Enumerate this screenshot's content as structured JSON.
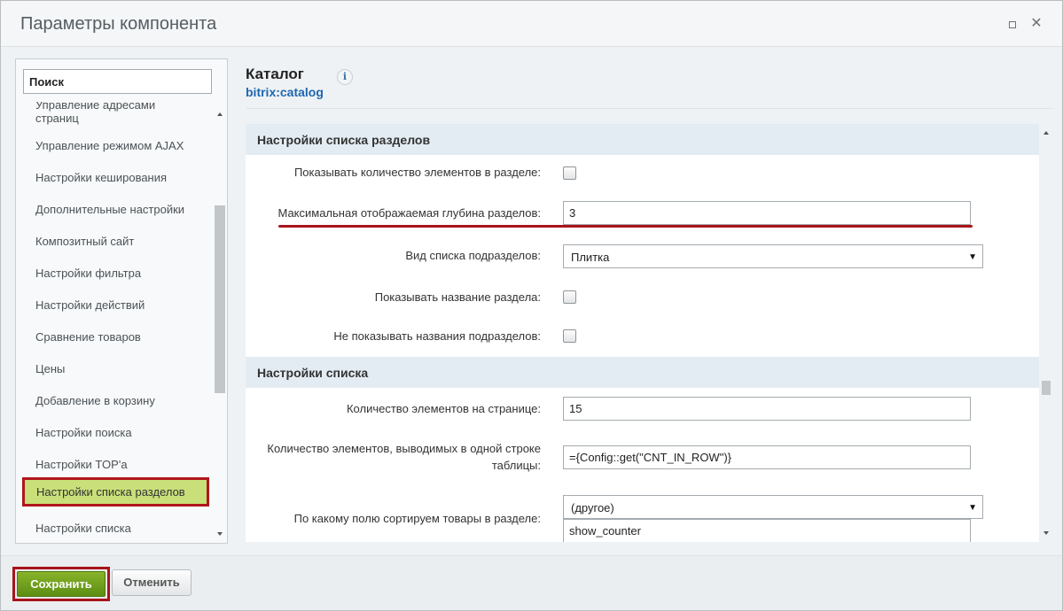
{
  "window": {
    "title": "Параметры компонента",
    "maximize_icon": "maximize-icon",
    "close_icon": "close-icon",
    "close_glyph": "✕"
  },
  "sidebar": {
    "search_value": "Поиск",
    "items": [
      {
        "label": "Управление адресами страниц"
      },
      {
        "label": "Управление режимом AJAX"
      },
      {
        "label": "Настройки кеширования"
      },
      {
        "label": "Дополнительные настройки"
      },
      {
        "label": "Композитный сайт"
      },
      {
        "label": "Настройки фильтра"
      },
      {
        "label": "Настройки действий"
      },
      {
        "label": "Сравнение товаров"
      },
      {
        "label": "Цены"
      },
      {
        "label": "Добавление в корзину"
      },
      {
        "label": "Настройки поиска"
      },
      {
        "label": "Настройки TOP'а"
      },
      {
        "label": "Настройки списка разделов",
        "selected": true
      },
      {
        "label": "Настройки списка"
      }
    ]
  },
  "component": {
    "title": "Каталог",
    "code": "bitrix:catalog",
    "info_glyph": "i"
  },
  "form": {
    "section_list_sections": {
      "title": "Настройки списка разделов",
      "show_count_label": "Показывать количество элементов в разделе:",
      "show_count_checked": false,
      "max_depth_label": "Максимальная отображаемая глубина разделов:",
      "max_depth_value": "3",
      "view_label": "Вид списка подразделов:",
      "view_value": "Плитка",
      "show_name_label": "Показывать название раздела:",
      "show_name_checked": false,
      "hide_sub_names_label": "Не показывать названия подразделов:",
      "hide_sub_names_checked": false
    },
    "section_list": {
      "title": "Настройки списка",
      "per_page_label": "Количество элементов на странице:",
      "per_page_value": "15",
      "per_row_label": "Количество элементов, выводимых в одной строке таблицы:",
      "per_row_value": "={Config::get(\"CNT_IN_ROW\")}",
      "sort_label": "По какому полю сортируем товары в разделе:",
      "sort_value": "(другое)",
      "sort_custom_value": "show_counter"
    },
    "select_arrow": "▼"
  },
  "footer": {
    "save_label": "Сохранить",
    "cancel_label": "Отменить"
  },
  "colors": {
    "accent_green": "#6e9e1c",
    "highlight_red": "#a8141a",
    "selected_item_bg": "#c9df79",
    "section_bg": "#e4ecf3",
    "link_blue": "#2067b0"
  }
}
